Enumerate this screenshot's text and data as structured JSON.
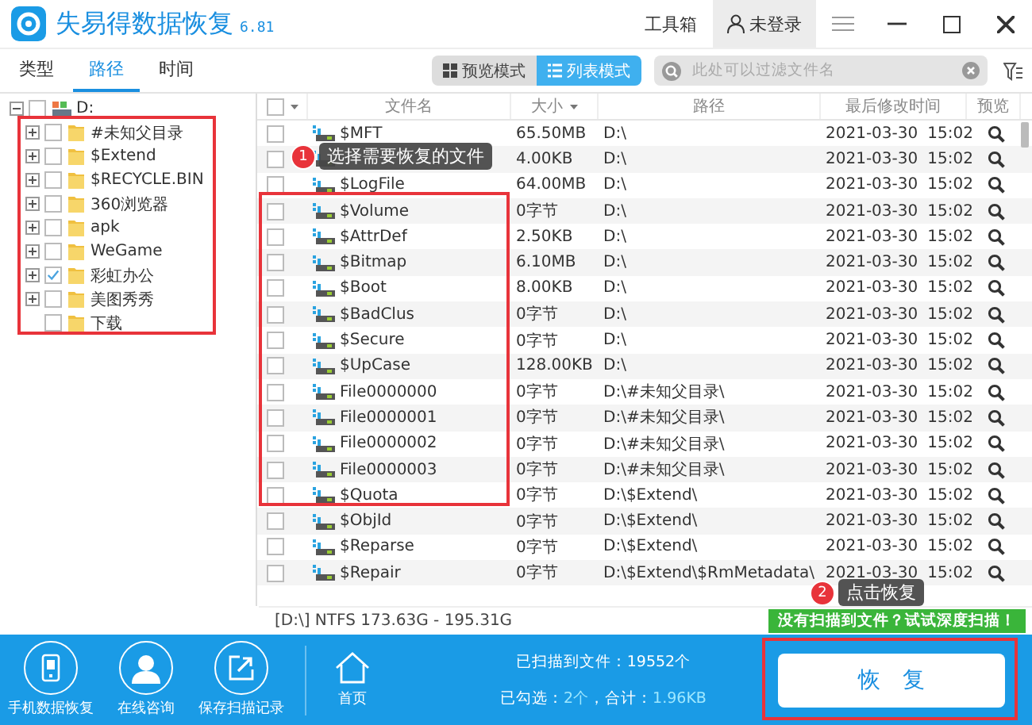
{
  "window": {
    "title": "失易得数据恢复",
    "version": "6.81",
    "toolbox": "工具箱",
    "user": "未登录"
  },
  "tabs": [
    {
      "label": "类型",
      "selected": false
    },
    {
      "label": "路径",
      "selected": true
    },
    {
      "label": "时间",
      "selected": false
    }
  ],
  "view_modes": [
    {
      "label": "预览模式",
      "kind": "grid",
      "selected": false
    },
    {
      "label": "列表模式",
      "kind": "list",
      "selected": true
    }
  ],
  "search": {
    "placeholder": "此处可以过滤文件名"
  },
  "tree": {
    "label": "D:",
    "checked": false,
    "expanded": true,
    "children": [
      {
        "label": "#未知父目录",
        "checked": false,
        "expandable": true
      },
      {
        "label": "$Extend",
        "checked": false,
        "expandable": true
      },
      {
        "label": "$RECYCLE.BIN",
        "checked": false,
        "expandable": true
      },
      {
        "label": "360浏览器",
        "checked": false,
        "expandable": true
      },
      {
        "label": "apk",
        "checked": false,
        "expandable": true
      },
      {
        "label": "WeGame",
        "checked": false,
        "expandable": true
      },
      {
        "label": "彩虹办公",
        "checked": true,
        "expandable": true
      },
      {
        "label": "美图秀秀",
        "checked": false,
        "expandable": true
      },
      {
        "label": "下载",
        "checked": false,
        "expandable": false
      }
    ]
  },
  "table": {
    "select_all_checked": false,
    "columns": [
      "文件名",
      "大小",
      "路径",
      "最后修改时间",
      "预览"
    ],
    "rows": [
      {
        "name": "$MFT",
        "size": "65.50MB",
        "path": "D:\\",
        "date": "2021-03-30",
        "time": "15:02",
        "checked": false
      },
      {
        "size": "4.00KB",
        "path": "D:\\",
        "date": "2021-03-30",
        "time": "15:02",
        "checked": false
      },
      {
        "name": "$LogFile",
        "size": "64.00MB",
        "path": "D:\\",
        "date": "2021-03-30",
        "time": "15:02",
        "checked": false
      },
      {
        "name": "$Volume",
        "size": "0字节",
        "path": "D:\\",
        "date": "2021-03-30",
        "time": "15:02",
        "checked": false
      },
      {
        "name": "$AttrDef",
        "size": "2.50KB",
        "path": "D:\\",
        "date": "2021-03-30",
        "time": "15:02",
        "checked": false
      },
      {
        "name": "$Bitmap",
        "size": "6.10MB",
        "path": "D:\\",
        "date": "2021-03-30",
        "time": "15:02",
        "checked": false
      },
      {
        "name": "$Boot",
        "size": "8.00KB",
        "path": "D:\\",
        "date": "2021-03-30",
        "time": "15:02",
        "checked": false
      },
      {
        "name": "$BadClus",
        "size": "0字节",
        "path": "D:\\",
        "date": "2021-03-30",
        "time": "15:02",
        "checked": false
      },
      {
        "name": "$Secure",
        "size": "0字节",
        "path": "D:\\",
        "date": "2021-03-30",
        "time": "15:02",
        "checked": false
      },
      {
        "name": "$UpCase",
        "size": "128.00KB",
        "path": "D:\\",
        "date": "2021-03-30",
        "time": "15:02",
        "checked": false
      },
      {
        "name": "File0000000",
        "size": "0字节",
        "path": "D:\\#未知父目录\\",
        "date": "2021-03-30",
        "time": "15:02",
        "checked": false
      },
      {
        "name": "File0000001",
        "size": "0字节",
        "path": "D:\\#未知父目录\\",
        "date": "2021-03-30",
        "time": "15:02",
        "checked": false
      },
      {
        "name": "File0000002",
        "size": "0字节",
        "path": "D:\\#未知父目录\\",
        "date": "2021-03-30",
        "time": "15:02",
        "checked": false
      },
      {
        "name": "File0000003",
        "size": "0字节",
        "path": "D:\\#未知父目录\\",
        "date": "2021-03-30",
        "time": "15:02",
        "checked": false
      },
      {
        "name": "$Quota",
        "size": "0字节",
        "path": "D:\\$Extend\\",
        "date": "2021-03-30",
        "time": "15:02",
        "checked": false
      },
      {
        "name": "$ObjId",
        "size": "0字节",
        "path": "D:\\$Extend\\",
        "date": "2021-03-30",
        "time": "15:02",
        "checked": false
      },
      {
        "name": "$Reparse",
        "size": "0字节",
        "path": "D:\\$Extend\\",
        "date": "2021-03-30",
        "time": "15:02",
        "checked": false
      },
      {
        "name": "$Repair",
        "size": "0字节",
        "path": "D:\\$Extend\\$RmMetadata\\",
        "date": "2021-03-30",
        "time": "15:02",
        "checked": false
      }
    ]
  },
  "status_bar": {
    "disk": "[D:\\] NTFS 173.63G - 195.31G",
    "deep_scan": "没有扫描到文件？试试深度扫描！"
  },
  "bottom_bar": {
    "actions": [
      {
        "label": "手机数据恢复",
        "kind": "phone"
      },
      {
        "label": "在线咨询",
        "kind": "person"
      },
      {
        "label": "保存扫描记录",
        "kind": "export"
      }
    ],
    "home": "首页",
    "scanned": "已扫描到文件：19552个",
    "checked_label": "已勾选：",
    "checked_count": "2个",
    "total_label": "，合计：",
    "total": "1.96KB",
    "recover": "恢　复"
  },
  "annotations": [
    {
      "number": "1",
      "text": "选择需要恢复的文件",
      "kind": "files"
    },
    {
      "number": "2",
      "text": "点击恢复",
      "kind": "recover"
    }
  ]
}
